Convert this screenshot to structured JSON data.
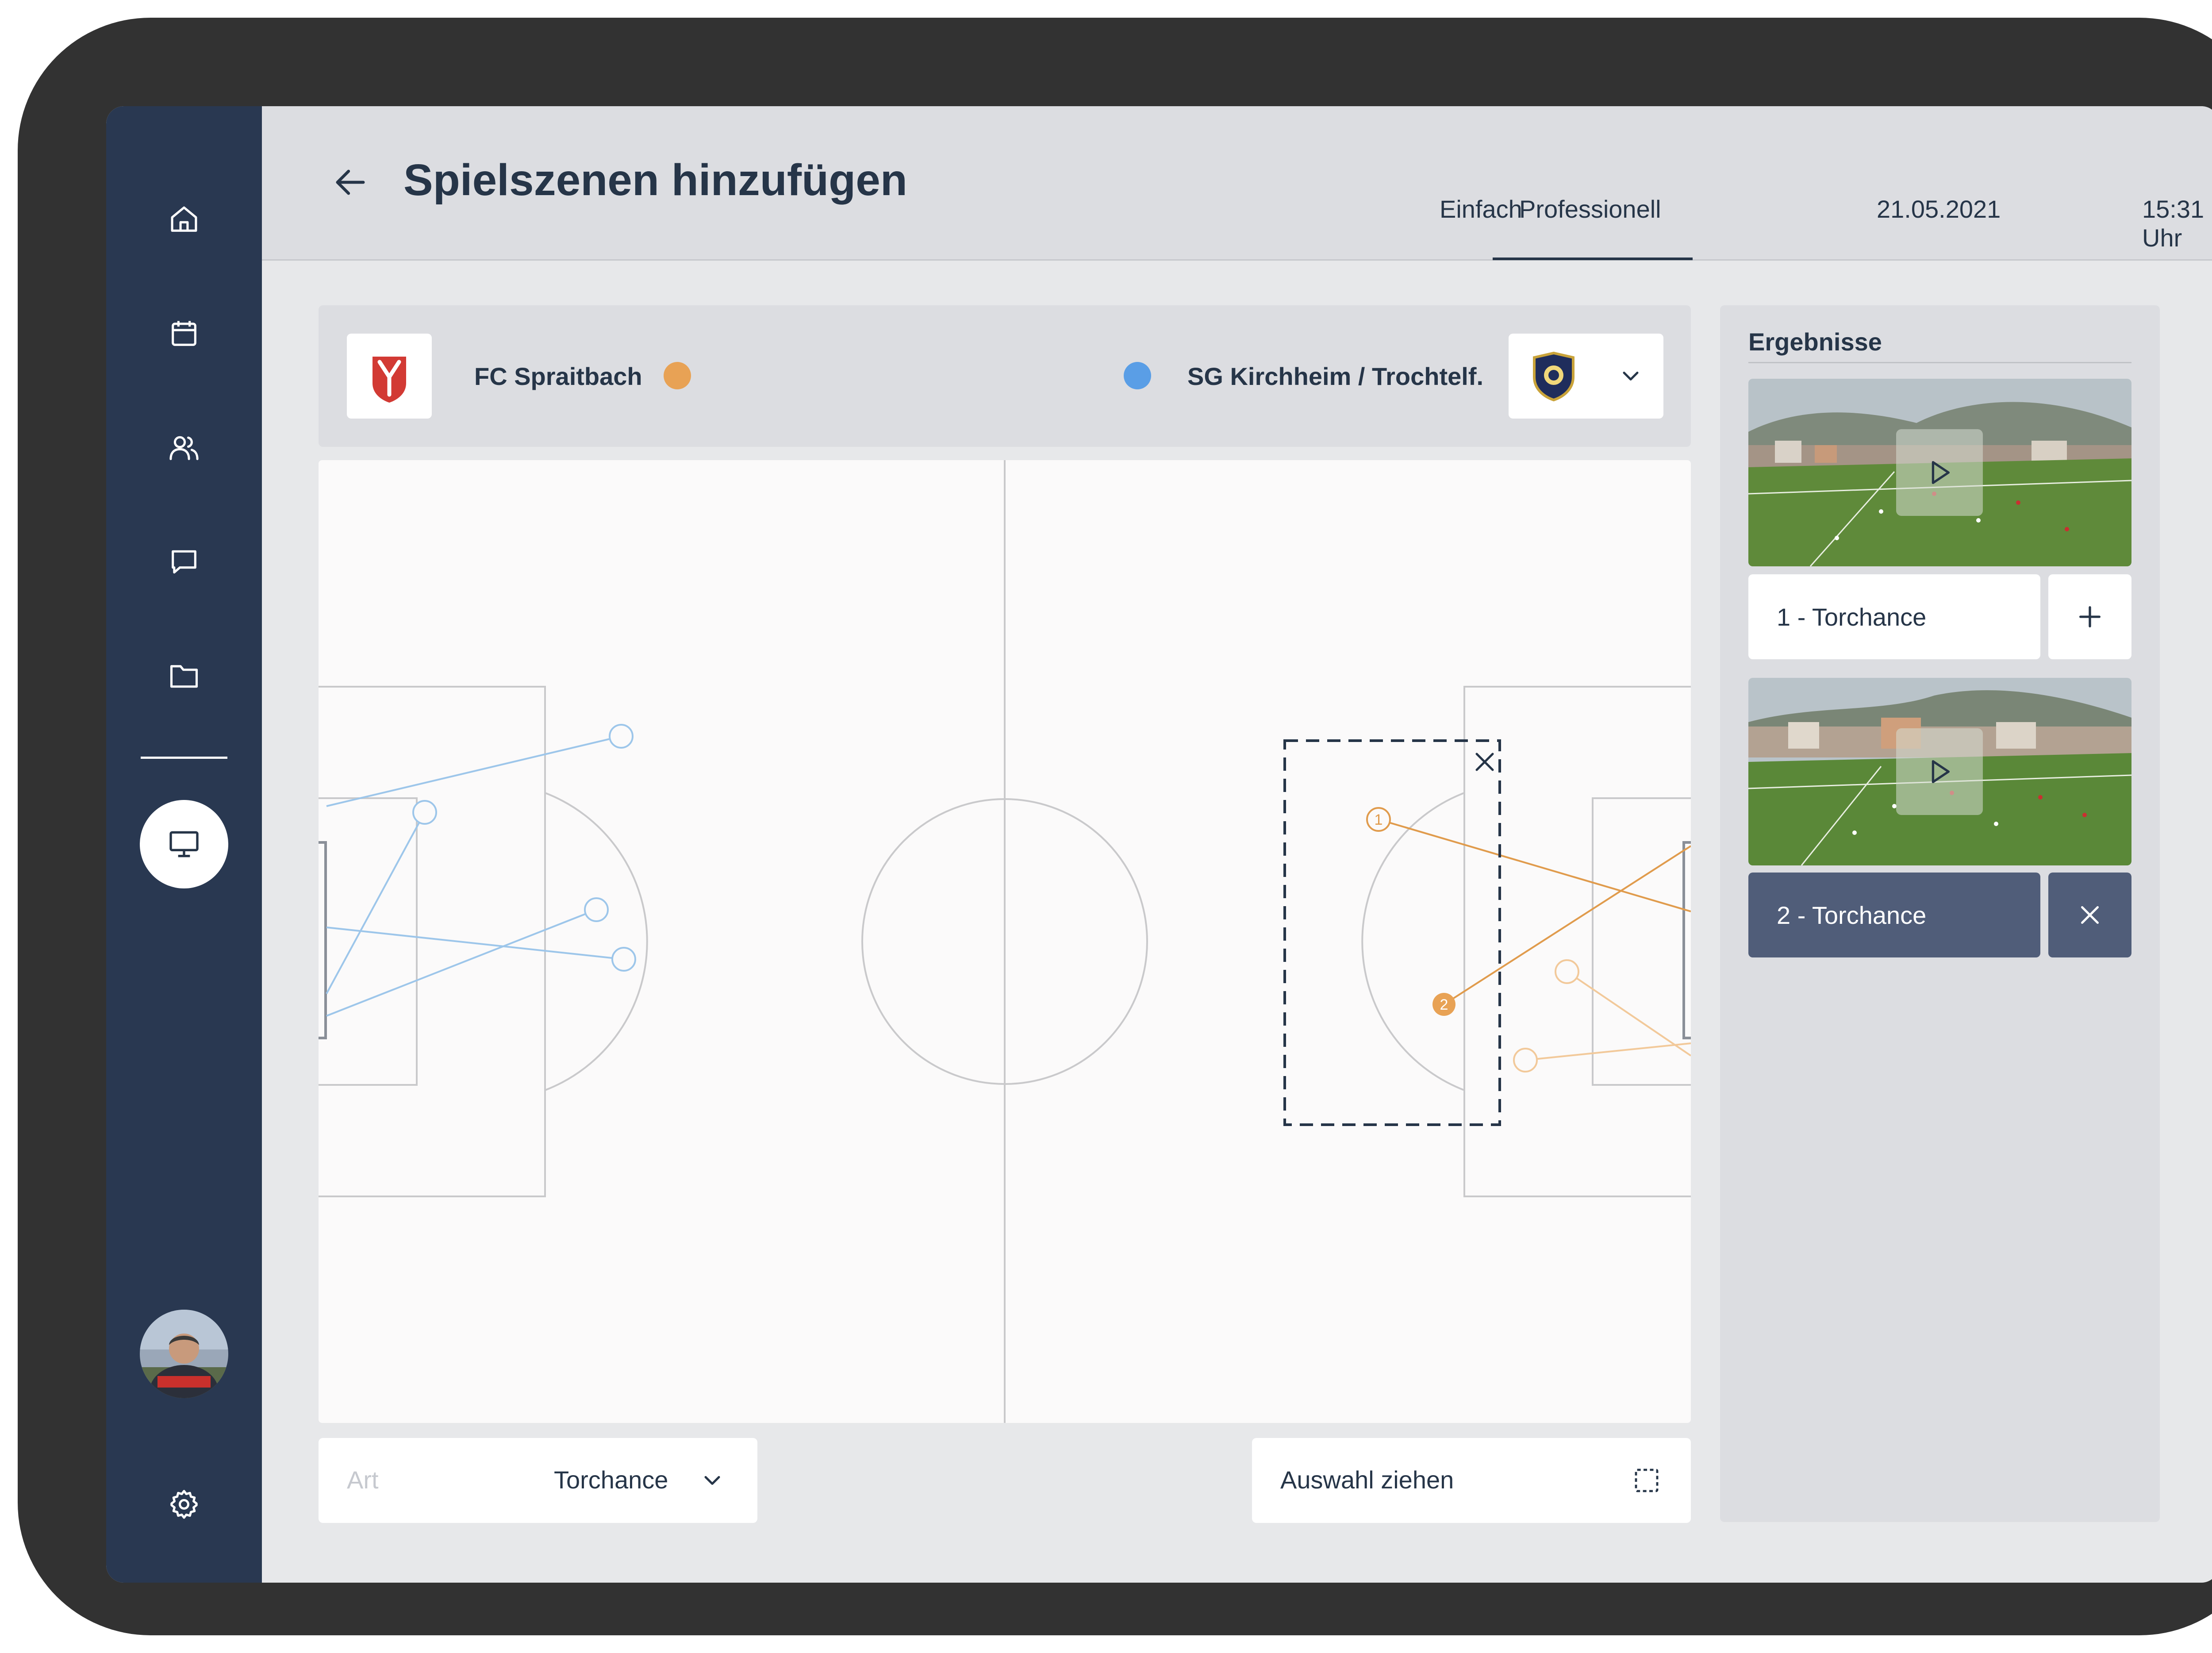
{
  "header": {
    "title": "Spielszenen hinzufügen",
    "tabs": [
      {
        "label": "Einfach",
        "active": false
      },
      {
        "label": "Professionell",
        "active": true
      }
    ],
    "date": "21.05.2021",
    "time": "15:31 Uhr"
  },
  "teams": {
    "home": {
      "name": "FC Spraitbach",
      "color": "#e8a255"
    },
    "away": {
      "name": "SG Kirchheim / Trochtelf.",
      "color": "#5a9ee6"
    }
  },
  "markers": {
    "one": "1",
    "two": "2"
  },
  "controls": {
    "type_label": "Art",
    "type_value": "Torchance",
    "selection_label": "Auswahl ziehen"
  },
  "results": {
    "title": "Ergebnisse",
    "items": [
      {
        "label": "1 - Torchance",
        "action": "add",
        "selected": false
      },
      {
        "label": "2 - Torchance",
        "action": "remove",
        "selected": true
      }
    ]
  },
  "colors": {
    "sidebar": "#293851",
    "accent": "#263548",
    "selected_item": "#505d79",
    "home_team": "#e8a255",
    "away_team": "#5a9ee6"
  },
  "icons": {
    "sidebar": [
      "home-icon",
      "calendar-icon",
      "users-icon",
      "chat-icon",
      "folder-icon",
      "monitor-icon",
      "settings-icon"
    ]
  }
}
